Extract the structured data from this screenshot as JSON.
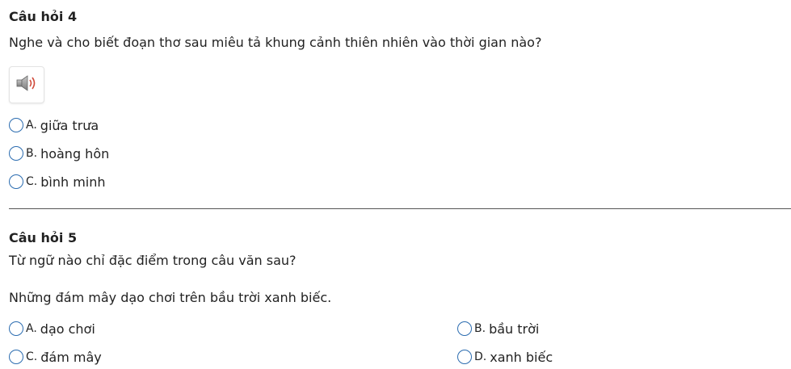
{
  "question4": {
    "title": "Câu hỏi 4",
    "prompt": "Nghe và cho biết đoạn thơ sau miêu tả khung cảnh thiên nhiên vào thời gian nào?",
    "audio_icon": "speaker-icon",
    "options": [
      {
        "key": "A.",
        "text": "giữa trưa"
      },
      {
        "key": "B.",
        "text": "hoàng hôn"
      },
      {
        "key": "C.",
        "text": "bình minh"
      }
    ]
  },
  "question5": {
    "title": "Câu hỏi 5",
    "prompt": "Từ ngữ nào chỉ đặc điểm trong câu văn sau?",
    "sentence": "Những đám mây dạo chơi trên bầu trời xanh biếc.",
    "options": [
      {
        "key": "A.",
        "text": "dạo chơi"
      },
      {
        "key": "B.",
        "text": "bầu trời"
      },
      {
        "key": "C.",
        "text": "đám mây"
      },
      {
        "key": "D.",
        "text": "xanh biếc"
      }
    ]
  },
  "colors": {
    "radio_border": "#2b6cb0",
    "text": "#222222",
    "divider": "#555555"
  }
}
